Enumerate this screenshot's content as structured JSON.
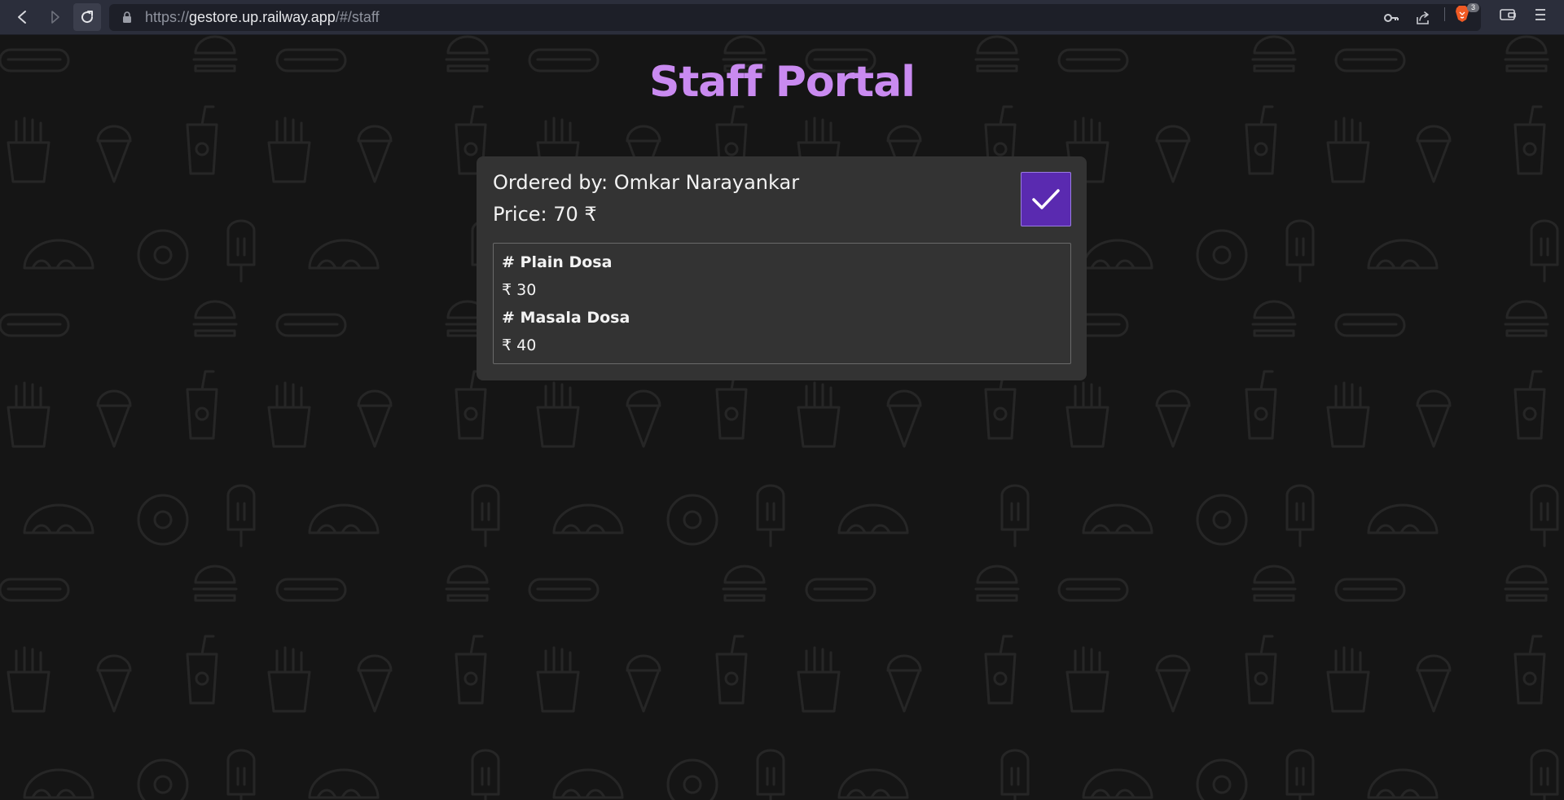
{
  "browser": {
    "url_prefix": "https://",
    "url_host": "gestore.up.railway.app",
    "url_path": "/#/staff",
    "shield_count": "3"
  },
  "page": {
    "title": "Staff Portal"
  },
  "order": {
    "ordered_by": "Ordered by: Omkar Narayankar",
    "price": "Price: 70 ₹",
    "items": [
      {
        "name": "# Plain Dosa",
        "price": "₹ 30"
      },
      {
        "name": "# Masala Dosa",
        "price": "₹ 40"
      }
    ]
  },
  "colors": {
    "title": "#c98af0",
    "accent_button": "#5a2ab0",
    "card": "#333333",
    "background": "#151515"
  }
}
